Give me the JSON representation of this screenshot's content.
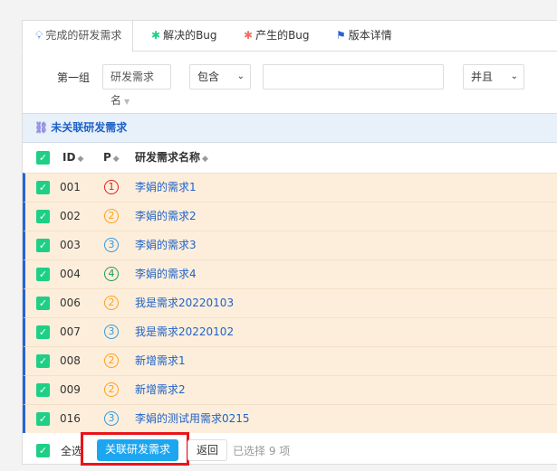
{
  "tabs": [
    {
      "label": "完成的研发需求",
      "icon": "lightbulb-icon"
    },
    {
      "label": "解决的Bug",
      "icon": "bug-icon"
    },
    {
      "label": "产生的Bug",
      "icon": "bug-icon"
    },
    {
      "label": "版本详情",
      "icon": "flag-icon"
    }
  ],
  "filter": {
    "group_label": "第一组",
    "field": "研发需求名",
    "operator": "包含",
    "value": "",
    "logic": "并且"
  },
  "section_title": "未关联研发需求",
  "columns": {
    "id": "ID",
    "p": "P",
    "name": "研发需求名称"
  },
  "rows": [
    {
      "id": "001",
      "p": "1",
      "name": "李娟的需求1"
    },
    {
      "id": "002",
      "p": "2",
      "name": "李娟的需求2"
    },
    {
      "id": "003",
      "p": "3",
      "name": "李娟的需求3"
    },
    {
      "id": "004",
      "p": "4",
      "name": "李娟的需求4"
    },
    {
      "id": "006",
      "p": "2",
      "name": "我是需求20220103"
    },
    {
      "id": "007",
      "p": "3",
      "name": "我是需求20220102"
    },
    {
      "id": "008",
      "p": "2",
      "name": "新增需求1"
    },
    {
      "id": "009",
      "p": "2",
      "name": "新增需求2"
    },
    {
      "id": "016",
      "p": "3",
      "name": "李娟的测试用需求0215"
    }
  ],
  "priority_colors": {
    "1": "#e02020",
    "2": "#ff9f1a",
    "3": "#2f9ae0",
    "4": "#1e9a5a"
  },
  "footer": {
    "select_all": "全选",
    "link_button": "关联研发需求",
    "back_button": "返回",
    "selected_text": "已选择 9 项"
  }
}
